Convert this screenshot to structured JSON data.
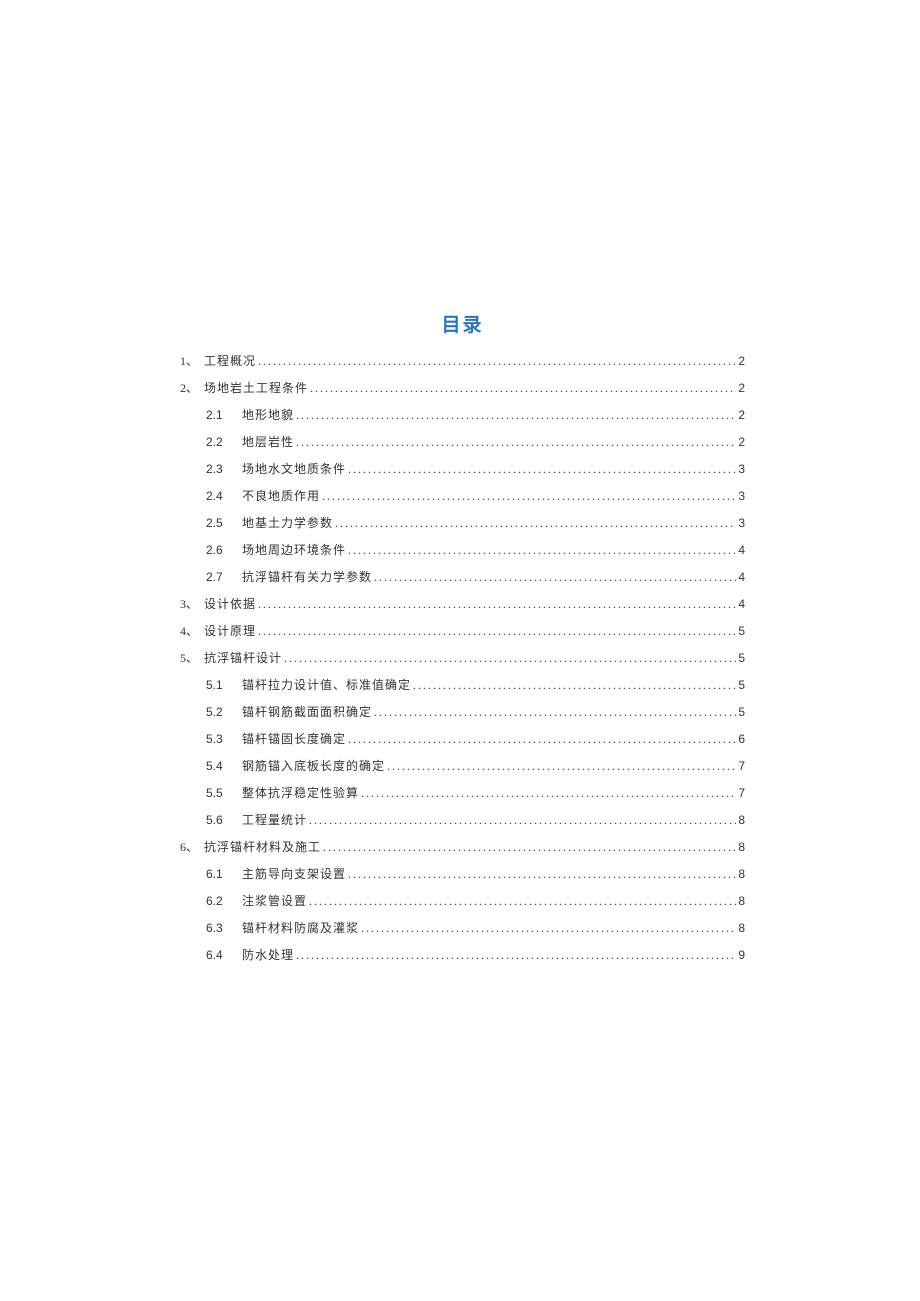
{
  "title": "目录",
  "entries": [
    {
      "level": 1,
      "num": "1、",
      "text": "工程概况",
      "page": "2"
    },
    {
      "level": 1,
      "num": "2、",
      "text": "场地岩土工程条件",
      "page": "2"
    },
    {
      "level": 2,
      "num": "2.1",
      "text": "地形地貌",
      "page": "2"
    },
    {
      "level": 2,
      "num": "2.2",
      "text": "地层岩性 ",
      "page": "2"
    },
    {
      "level": 2,
      "num": "2.3",
      "text": "场地水文地质条件",
      "page": "3"
    },
    {
      "level": 2,
      "num": "2.4",
      "text": "不良地质作用 ",
      "page": "3"
    },
    {
      "level": 2,
      "num": "2.5",
      "text": "地基土力学参数",
      "page": "3"
    },
    {
      "level": 2,
      "num": "2.6",
      "text": "场地周边环境条件",
      "page": "4"
    },
    {
      "level": 2,
      "num": "2.7",
      "text": "抗浮锚杆有关力学参数",
      "page": "4"
    },
    {
      "level": 1,
      "num": "3、",
      "text": "设计依据",
      "page": "4"
    },
    {
      "level": 1,
      "num": "4、",
      "text": "设计原理",
      "page": "5"
    },
    {
      "level": 1,
      "num": "5、",
      "text": "抗浮锚杆设计",
      "page": "5"
    },
    {
      "level": 2,
      "num": "5.1",
      "text": "锚杆拉力设计值、标准值确定",
      "page": "5"
    },
    {
      "level": 2,
      "num": "5.2",
      "text": "锚杆钢筋截面面积确定",
      "page": "5"
    },
    {
      "level": 2,
      "num": "5.3",
      "text": "锚杆锚固长度确定",
      "page": "6"
    },
    {
      "level": 2,
      "num": "5.4",
      "text": "钢筋锚入底板长度的确定 ",
      "page": "7"
    },
    {
      "level": 2,
      "num": "5.5",
      "text": "整体抗浮稳定性验算",
      "page": "7"
    },
    {
      "level": 2,
      "num": "5.6",
      "text": "工程量统计 ",
      "page": "8"
    },
    {
      "level": 1,
      "num": "6、",
      "text": "抗浮锚杆材料及施工",
      "page": "8"
    },
    {
      "level": 2,
      "num": "6.1",
      "text": "主筋导向支架设置",
      "page": "8"
    },
    {
      "level": 2,
      "num": "6.2",
      "text": "注浆管设置 ",
      "page": "8"
    },
    {
      "level": 2,
      "num": "6.3",
      "text": "锚杆材料防腐及灌浆",
      "page": "8"
    },
    {
      "level": 2,
      "num": "6.4",
      "text": "防水处理 ",
      "page": "9"
    }
  ]
}
